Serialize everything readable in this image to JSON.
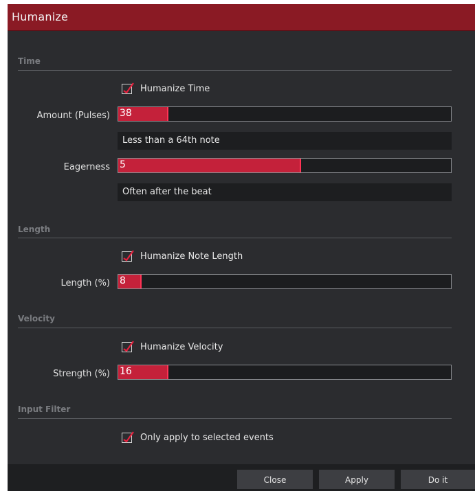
{
  "window": {
    "title": "Humanize"
  },
  "sections": {
    "time": {
      "label": "Time",
      "checkbox_label": "Humanize Time",
      "checked": true,
      "amount": {
        "label": "Amount (Pulses)",
        "value": "38",
        "level_percent": 15,
        "info": "Less than a 64th note"
      },
      "eagerness": {
        "label": "Eagerness",
        "value": "5",
        "level_percent": 55,
        "info": "Often after the beat"
      }
    },
    "length": {
      "label": "Length",
      "checkbox_label": "Humanize Note Length",
      "checked": true,
      "length": {
        "label": "Length (%)",
        "value": "8",
        "level_percent": 7
      }
    },
    "velocity": {
      "label": "Velocity",
      "checkbox_label": "Humanize Velocity",
      "checked": true,
      "strength": {
        "label": "Strength (%)",
        "value": "16",
        "level_percent": 15
      }
    },
    "input_filter": {
      "label": "Input Filter",
      "checkbox_label": "Only apply to selected events",
      "checked": true
    }
  },
  "footer": {
    "close": "Close",
    "apply": "Apply",
    "do_it": "Do it"
  },
  "colors": {
    "accent": "#c4213a",
    "titlebar": "#8a1a24",
    "background": "#2b2c2f"
  }
}
